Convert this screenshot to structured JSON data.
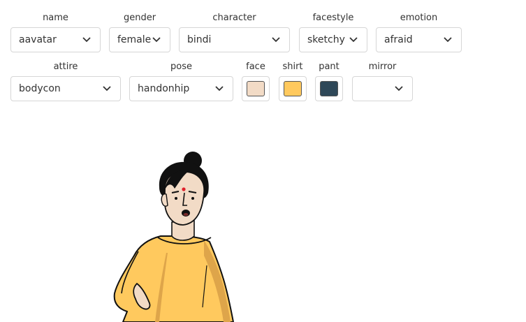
{
  "controls": {
    "name": {
      "label": "name",
      "value": "aavatar"
    },
    "gender": {
      "label": "gender",
      "value": "female"
    },
    "character": {
      "label": "character",
      "value": "bindi"
    },
    "facestyle": {
      "label": "facestyle",
      "value": "sketchy"
    },
    "emotion": {
      "label": "emotion",
      "value": "afraid"
    },
    "attire": {
      "label": "attire",
      "value": "bodycon"
    },
    "pose": {
      "label": "pose",
      "value": "handonhip"
    },
    "face": {
      "label": "face",
      "color": "#f2dbc6"
    },
    "shirt": {
      "label": "shirt",
      "color": "#ffc95e"
    },
    "pant": {
      "label": "pant",
      "color": "#2f4858"
    },
    "mirror": {
      "label": "mirror",
      "value": ""
    }
  },
  "avatar": {
    "skin": "#f2dbc6",
    "shirt": "#ffc95e",
    "shirt_shadow": "#dea54a",
    "hair": "#111111",
    "bindi": "#e0202a"
  }
}
